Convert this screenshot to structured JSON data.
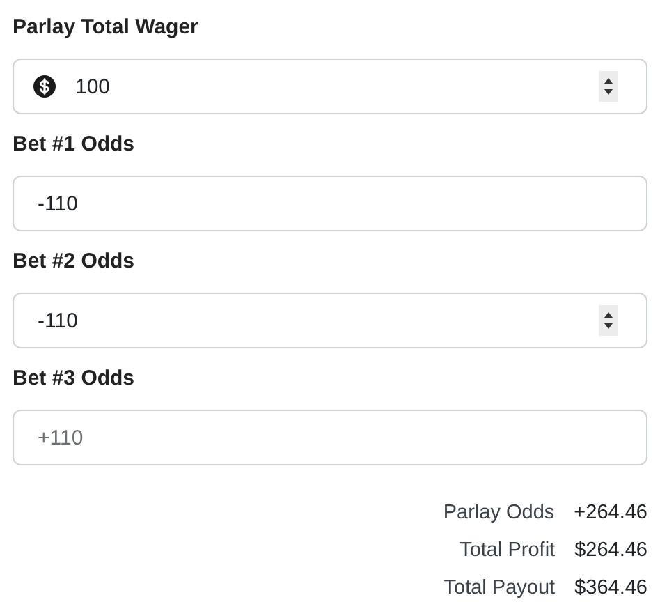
{
  "fields": [
    {
      "label": "Parlay Total Wager",
      "value": "100",
      "currency_icon": true,
      "stepper": true
    },
    {
      "label": "Bet #1 Odds",
      "value": "-110",
      "stepper": false
    },
    {
      "label": "Bet #2 Odds",
      "value": "-110",
      "stepper": true
    },
    {
      "label": "Bet #3 Odds",
      "placeholder": "+110",
      "stepper": false
    }
  ],
  "results": [
    {
      "label": "Parlay Odds",
      "value": "+264.46"
    },
    {
      "label": "Total Profit",
      "value": "$264.46"
    },
    {
      "label": "Total Payout",
      "value": "$364.46"
    }
  ]
}
